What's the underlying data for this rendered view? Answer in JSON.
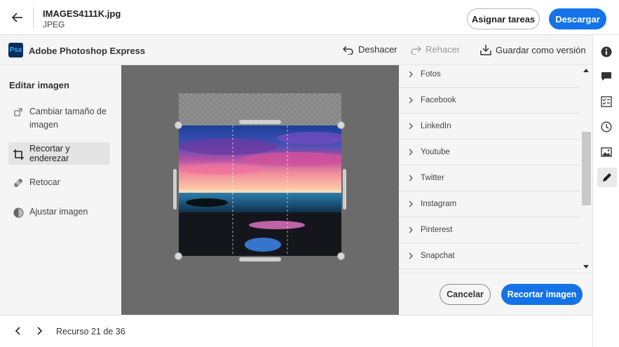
{
  "header": {
    "file_name": "IMAGES4111K.jpg",
    "file_type": "JPEG",
    "assign_label": "Asignar tareas",
    "download_label": "Descargar",
    "back_icon": "arrow-left-icon"
  },
  "toolbar": {
    "app_logo": "Psx",
    "app_title": "Adobe Photoshop Express",
    "undo_label": "Deshacer",
    "redo_label": "Rehacer",
    "save_version_label": "Guardar como versión"
  },
  "left_panel": {
    "heading": "Editar imagen",
    "items": [
      {
        "label": "Cambiar tamaño de imagen",
        "icon": "resize-icon"
      },
      {
        "label": "Recortar y enderezar",
        "icon": "crop-icon",
        "selected": true
      },
      {
        "label": "Retocar",
        "icon": "bandage-icon"
      },
      {
        "label": "Ajustar imagen",
        "icon": "adjust-icon"
      }
    ]
  },
  "presets": {
    "items": [
      "Fotos",
      "Facebook",
      "LinkedIn",
      "Youtube",
      "Twitter",
      "Instagram",
      "Pinterest",
      "Snapchat"
    ]
  },
  "actions": {
    "cancel_label": "Cancelar",
    "crop_label": "Recortar imagen"
  },
  "footer": {
    "counter": "Recurso 21 de 36"
  },
  "colors": {
    "accent": "#1473e6",
    "canvas_bg": "#6b6b6b",
    "panel_bg": "#f5f5f5"
  },
  "rail_icons": [
    "info-icon",
    "comment-icon",
    "checklist-icon",
    "history-icon",
    "image-icon",
    "edit-icon"
  ]
}
